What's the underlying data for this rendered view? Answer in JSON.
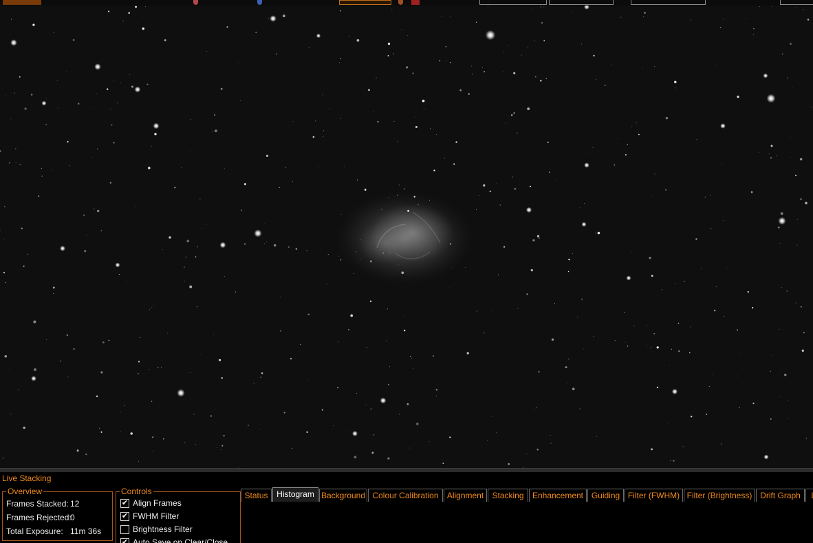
{
  "panel": {
    "title": "Live Stacking",
    "overview": {
      "legend": "Overview",
      "frames_stacked_label": "Frames Stacked:",
      "frames_stacked_value": "12",
      "frames_rejected_label": "Frames Rejected:",
      "frames_rejected_value": "0",
      "total_exposure_label": "Total Exposure:",
      "total_exposure_value": "11m 36s"
    },
    "controls": {
      "legend": "Controls",
      "items": [
        {
          "label": "Align Frames",
          "checked": true
        },
        {
          "label": "FWHM Filter",
          "checked": true
        },
        {
          "label": "Brightness Filter",
          "checked": false
        },
        {
          "label": "Auto Save on Clear/Close",
          "checked": true
        }
      ]
    },
    "tabs": [
      {
        "label": "Status",
        "active": false
      },
      {
        "label": "Histogram",
        "active": true
      },
      {
        "label": "Background",
        "active": false
      },
      {
        "label": "Colour Calibration",
        "active": false
      },
      {
        "label": "Alignment",
        "active": false
      },
      {
        "label": "Stacking",
        "active": false
      },
      {
        "label": "Enhancement",
        "active": false
      },
      {
        "label": "Guiding",
        "active": false
      },
      {
        "label": "Filter (FWHM)",
        "active": false
      },
      {
        "label": "Filter (Brightness)",
        "active": false
      },
      {
        "label": "Drift Graph",
        "active": false
      },
      {
        "label": "Lo",
        "active": false
      }
    ]
  },
  "colors": {
    "accent": "#f08a1c",
    "groupbox_border": "#a8581a",
    "text": "#ececec",
    "sky": "#0f0f0f"
  },
  "icons": [
    "check-icon",
    "nebula-image",
    "star-field"
  ]
}
